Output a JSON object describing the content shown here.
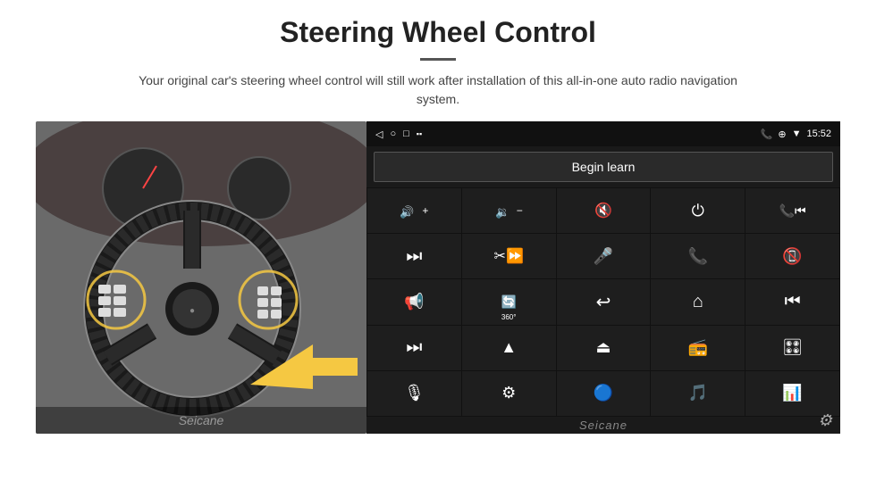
{
  "header": {
    "title": "Steering Wheel Control",
    "divider": true,
    "subtitle": "Your original car's steering wheel control will still work after installation of this all-in-one auto radio navigation system."
  },
  "statusbar": {
    "left": [
      "◁",
      "○",
      "□",
      "▪▪"
    ],
    "right_icons": [
      "📞",
      "⊕",
      "▼",
      "15:52"
    ]
  },
  "begin_learn": {
    "label": "Begin learn"
  },
  "controls": [
    {
      "id": "vol-up",
      "icon": "🔊+"
    },
    {
      "id": "vol-down",
      "icon": "🔉−"
    },
    {
      "id": "mute",
      "icon": "🔇"
    },
    {
      "id": "power",
      "icon": "⏻"
    },
    {
      "id": "prev-track-phone",
      "icon": "📞⏮"
    },
    {
      "id": "next-track",
      "icon": "⏭"
    },
    {
      "id": "fast-forward",
      "icon": "⏩"
    },
    {
      "id": "mic",
      "icon": "🎤"
    },
    {
      "id": "phone",
      "icon": "📞"
    },
    {
      "id": "hang-up",
      "icon": "📵"
    },
    {
      "id": "horn",
      "icon": "📢"
    },
    {
      "id": "360-cam",
      "icon": "🔄"
    },
    {
      "id": "back",
      "icon": "↩"
    },
    {
      "id": "home",
      "icon": "⌂"
    },
    {
      "id": "rewind",
      "icon": "⏮"
    },
    {
      "id": "skip-forward",
      "icon": "⏭"
    },
    {
      "id": "navigate",
      "icon": "▶"
    },
    {
      "id": "eject",
      "icon": "⏏"
    },
    {
      "id": "radio",
      "icon": "📻"
    },
    {
      "id": "eq",
      "icon": "🎛"
    },
    {
      "id": "mic2",
      "icon": "🎙"
    },
    {
      "id": "settings2",
      "icon": "⚙"
    },
    {
      "id": "bluetooth",
      "icon": "🔵"
    },
    {
      "id": "music",
      "icon": "🎵"
    },
    {
      "id": "spectrum",
      "icon": "📊"
    }
  ],
  "watermark": "Seicane",
  "gear_icon": "⚙"
}
